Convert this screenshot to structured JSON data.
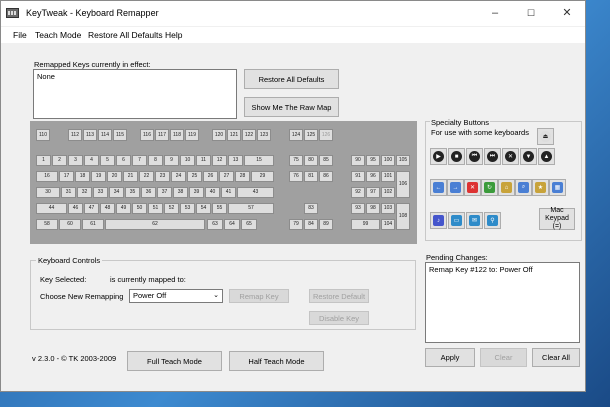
{
  "window": {
    "title": "KeyTweak -  Keyboard Remapper",
    "minimize": "–",
    "maximize": "☐",
    "close": "✕"
  },
  "menu": [
    "File",
    "Teach Mode",
    "Restore All Defaults",
    "Help"
  ],
  "remapped": {
    "label": "Remapped Keys currently in effect:",
    "value": "None",
    "restore_all_label": "Restore All Defaults",
    "raw_map_label": "Show Me The Raw Map"
  },
  "keyboard": {
    "fn_row": [
      "110",
      "112",
      "113",
      "114",
      "115",
      "116",
      "117",
      "118",
      "119",
      "120",
      "121",
      "122",
      "123",
      "124",
      "125",
      "126"
    ],
    "row1": [
      "1",
      "2",
      "3",
      "4",
      "5",
      "6",
      "7",
      "8",
      "9",
      "10",
      "11",
      "12",
      "13",
      "15"
    ],
    "row2": [
      "16",
      "17",
      "18",
      "19",
      "20",
      "21",
      "22",
      "23",
      "24",
      "25",
      "26",
      "27",
      "28",
      "29"
    ],
    "row3": [
      "30",
      "31",
      "32",
      "33",
      "34",
      "35",
      "36",
      "37",
      "38",
      "39",
      "40",
      "41",
      "43"
    ],
    "row4": [
      "44",
      "46",
      "47",
      "48",
      "49",
      "50",
      "51",
      "52",
      "53",
      "54",
      "55",
      "57"
    ],
    "row5": [
      "58",
      "60",
      "61",
      "62",
      "63",
      "64",
      "65"
    ],
    "nav_top": [
      "75",
      "80",
      "85",
      "76",
      "81",
      "86"
    ],
    "arrows": [
      "83",
      "79",
      "84",
      "89"
    ],
    "numpad": [
      "90",
      "95",
      "100",
      "105",
      "91",
      "96",
      "101",
      "92",
      "97",
      "102",
      "106",
      "93",
      "98",
      "103",
      "99",
      "104",
      "108"
    ]
  },
  "specialty": {
    "title": "Specialty Buttons",
    "subtitle": "For use with some keyboards",
    "mac_keypad_label": "Mac Keypad (=)",
    "icons": [
      "eject-icon",
      "play-icon",
      "stop-icon",
      "prev-track-icon",
      "next-track-icon",
      "mute-icon",
      "volume-down-icon",
      "volume-up-icon",
      "back-icon",
      "forward-icon",
      "stop-browser-icon",
      "refresh-icon",
      "home-icon",
      "search-icon",
      "favorites-icon",
      "calculator-icon",
      "media-icon",
      "my-computer-icon",
      "mail-icon",
      "search-key-icon"
    ]
  },
  "keyboard_controls": {
    "title": "Keyboard Controls",
    "key_selected_label": "Key Selected:",
    "mapped_to_label": "is currently mapped to:",
    "choose_label": "Choose New Remapping",
    "choose_value": "Power Off",
    "remap_label": "Remap Key",
    "restore_default_label": "Restore Default",
    "disable_label": "Disable Key"
  },
  "pending": {
    "label": "Pending Changes:",
    "value": "Remap Key #122 to: Power Off",
    "apply_label": "Apply",
    "clear_label": "Clear",
    "clear_all_label": "Clear All"
  },
  "footer": {
    "version": "v 2.3.0 - © TK 2003-2009",
    "full_teach_label": "Full Teach Mode",
    "half_teach_label": "Half Teach Mode"
  }
}
